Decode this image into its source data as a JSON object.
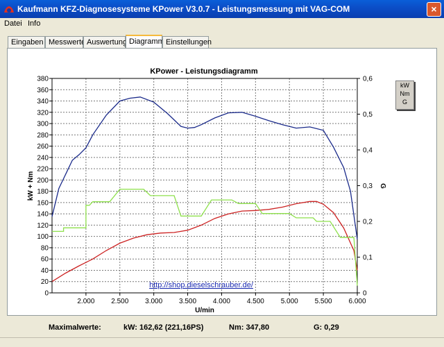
{
  "window": {
    "title": "Kaufmann KFZ-Diagnosesysteme  KPower V3.0.7 - Leistungsmessung mit VAG-COM",
    "close_label": "×"
  },
  "menu": [
    "Datei",
    "Info"
  ],
  "tabs": [
    "Eingaben",
    "Messwerte",
    "Auswertung",
    "Diagramm",
    "Einstellungen"
  ],
  "active_tab": "Diagramm",
  "chart": {
    "title": "KPower - Leistungsdiagramm",
    "xlabel": "U/min",
    "ylabel_left": "kW + Nm",
    "ylabel_right": "G",
    "watermark": "http://shop.dieselschrauber.de/",
    "legend": [
      "kW",
      "Nm",
      "G"
    ]
  },
  "chart_data": {
    "type": "line",
    "x_range": [
      1500,
      6000
    ],
    "x_ticks": [
      "2.000",
      "2.500",
      "3.000",
      "3.500",
      "4.000",
      "4.500",
      "5.000",
      "5.500",
      "6.000"
    ],
    "x_tick_values": [
      2000,
      2500,
      3000,
      3500,
      4000,
      4500,
      5000,
      5500,
      6000
    ],
    "y_left_range": [
      0,
      380
    ],
    "y_left_ticks": [
      0,
      20,
      40,
      60,
      80,
      100,
      120,
      140,
      160,
      180,
      200,
      220,
      240,
      260,
      280,
      300,
      320,
      340,
      360,
      380
    ],
    "y_right_range": [
      0,
      0.6
    ],
    "y_right_ticks": [
      "0",
      "0,1",
      "0,2",
      "0,3",
      "0,4",
      "0,5",
      "0,6"
    ],
    "y_right_tick_values": [
      0,
      0.1,
      0.2,
      0.3,
      0.4,
      0.5,
      0.6
    ],
    "grid": true,
    "series": [
      {
        "name": "kW",
        "color": "#cc2222",
        "axis": "left",
        "points": [
          [
            1500,
            20
          ],
          [
            1700,
            35
          ],
          [
            1900,
            48
          ],
          [
            2100,
            60
          ],
          [
            2300,
            75
          ],
          [
            2500,
            88
          ],
          [
            2700,
            97
          ],
          [
            2900,
            103
          ],
          [
            3100,
            106
          ],
          [
            3300,
            107
          ],
          [
            3500,
            111
          ],
          [
            3700,
            120
          ],
          [
            3900,
            132
          ],
          [
            4100,
            140
          ],
          [
            4300,
            145
          ],
          [
            4500,
            146
          ],
          [
            4700,
            148
          ],
          [
            4900,
            152
          ],
          [
            5100,
            158
          ],
          [
            5300,
            162
          ],
          [
            5400,
            162
          ],
          [
            5500,
            157
          ],
          [
            5650,
            142
          ],
          [
            5800,
            115
          ],
          [
            5950,
            75
          ],
          [
            6000,
            40
          ]
        ]
      },
      {
        "name": "Nm",
        "color": "#1a2a8a",
        "axis": "left",
        "points": [
          [
            1500,
            135
          ],
          [
            1600,
            185
          ],
          [
            1700,
            210
          ],
          [
            1800,
            235
          ],
          [
            1900,
            245
          ],
          [
            2000,
            257
          ],
          [
            2100,
            280
          ],
          [
            2300,
            315
          ],
          [
            2500,
            340
          ],
          [
            2650,
            345
          ],
          [
            2800,
            347
          ],
          [
            3000,
            338
          ],
          [
            3200,
            318
          ],
          [
            3400,
            295
          ],
          [
            3500,
            292
          ],
          [
            3600,
            293
          ],
          [
            3700,
            298
          ],
          [
            3900,
            310
          ],
          [
            4100,
            319
          ],
          [
            4300,
            320
          ],
          [
            4500,
            313
          ],
          [
            4700,
            305
          ],
          [
            4900,
            298
          ],
          [
            5100,
            292
          ],
          [
            5300,
            294
          ],
          [
            5500,
            288
          ],
          [
            5650,
            258
          ],
          [
            5800,
            222
          ],
          [
            5900,
            180
          ],
          [
            6000,
            95
          ]
        ]
      },
      {
        "name": "G",
        "color": "#8ee04c",
        "axis": "right",
        "points": [
          [
            1500,
            0.172
          ],
          [
            1670,
            0.172
          ],
          [
            1670,
            0.182
          ],
          [
            2000,
            0.182
          ],
          [
            2000,
            0.245
          ],
          [
            2050,
            0.245
          ],
          [
            2100,
            0.255
          ],
          [
            2350,
            0.255
          ],
          [
            2500,
            0.29
          ],
          [
            2850,
            0.29
          ],
          [
            2950,
            0.272
          ],
          [
            3300,
            0.272
          ],
          [
            3400,
            0.215
          ],
          [
            3700,
            0.215
          ],
          [
            3850,
            0.26
          ],
          [
            4150,
            0.26
          ],
          [
            4250,
            0.25
          ],
          [
            4500,
            0.25
          ],
          [
            4600,
            0.222
          ],
          [
            5000,
            0.222
          ],
          [
            5100,
            0.21
          ],
          [
            5350,
            0.21
          ],
          [
            5400,
            0.2
          ],
          [
            5600,
            0.2
          ],
          [
            5750,
            0.155
          ],
          [
            5950,
            0.155
          ],
          [
            6000,
            0.02
          ]
        ]
      }
    ]
  },
  "status": {
    "label": "Maximalwerte:",
    "kw": "kW: 162,62 (221,16PS)",
    "nm": "Nm: 347,80",
    "g": "G: 0,29"
  }
}
